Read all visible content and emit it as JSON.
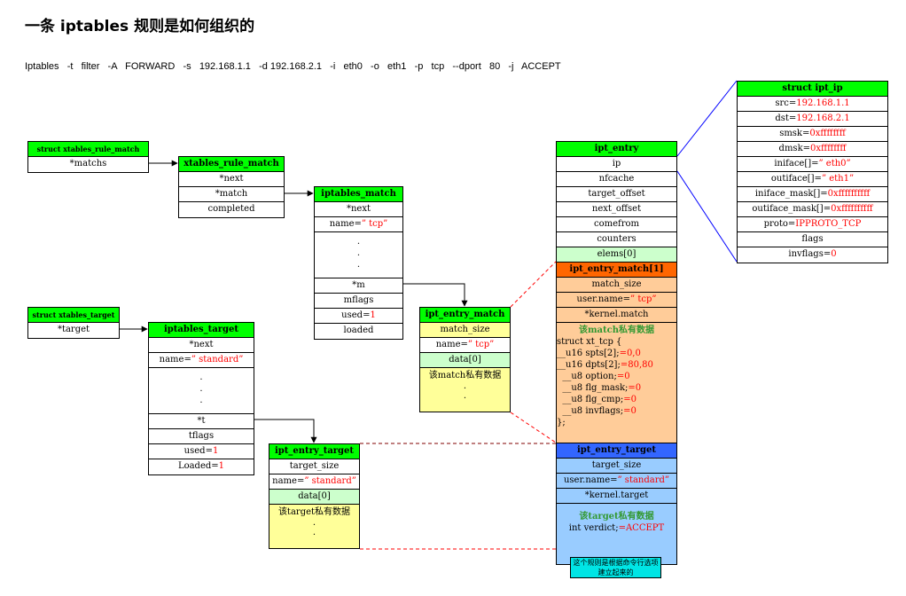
{
  "title": "一条 iptables 规则是如何组织的",
  "command": "Iptables   -t   filter   -A   FORWARD   -s   192.168.1.1   -d 192.168.2.1   -i   eth0   -o   eth1   -p   tcp   --dport   80   -j   ACCEPT",
  "xtables_rule_match_struct": {
    "header": "struct xtables_rule_match",
    "field": "*matchs"
  },
  "xtables_rule_match": {
    "header": "xtables_rule_match",
    "fields": [
      "*next",
      "*match",
      "completed"
    ]
  },
  "iptables_match": {
    "header": "iptables_match",
    "next": "*next",
    "name_label": "name=",
    "name_value": "” tcp”",
    "dots": ".\n.\n.",
    "m": "*m",
    "mflags": "mflags",
    "used_label": "used=",
    "used_value": "1",
    "loaded": "loaded"
  },
  "xtables_target_struct": {
    "header": "struct xtables_target",
    "field": "*target"
  },
  "iptables_target": {
    "header": "iptables_target",
    "next": "*next",
    "name_label": "name=",
    "name_value": "” standard”",
    "dots": ".\n.\n.",
    "t": "*t",
    "tflags": "tflags",
    "used_label": "used=",
    "used_value": "1",
    "loaded_label": "Loaded=",
    "loaded_value": "1"
  },
  "ipt_entry_match": {
    "header": "ipt_entry_match",
    "match_size": "match_size",
    "name_label": "name=",
    "name_value": "” tcp”",
    "data": "data[0]",
    "private": "该match私有数据",
    "dots": ".\n."
  },
  "ipt_entry_target": {
    "header": "ipt_entry_target",
    "target_size": "target_size",
    "name_label": "name=",
    "name_value": "” standard”",
    "data": "data[0]",
    "private": "该target私有数据",
    "dots": ".\n."
  },
  "ipt_entry": {
    "header": "ipt_entry",
    "fields": [
      "ip",
      "nfcache",
      "target_offset",
      "next_offset",
      "comefrom",
      "counters"
    ],
    "elems": "elems[0]",
    "match_header": "ipt_entry_match[1]",
    "match_size": "match_size",
    "user_name_label": "user.name=",
    "user_name_value": "” tcp”",
    "kernel_match": "*kernel.match",
    "match_private": "该match私有数据",
    "tcp_lines": [
      {
        "k": "struct xt_tcp {",
        "v": ""
      },
      {
        "k": "__u16 spts[2];",
        "v": "=0,0"
      },
      {
        "k": "__u16 dpts[2];",
        "v": "=80,80"
      },
      {
        "k": "  __u8 option;",
        "v": "=0"
      },
      {
        "k": "  __u8 flg_mask;",
        "v": "=0"
      },
      {
        "k": "  __u8 flg_cmp;",
        "v": "=0"
      },
      {
        "k": "  __u8 invflags;",
        "v": "=0"
      },
      {
        "k": "};",
        "v": ""
      }
    ],
    "target_header": "ipt_entry_target",
    "target_size": "target_size",
    "user_target_label": "user.name=",
    "user_target_value": "” standard”",
    "kernel_target": "*kernel.target",
    "target_private": "该target私有数据",
    "verdict_label": "int verdict;",
    "verdict_value": "=ACCEPT"
  },
  "ipt_ip": {
    "header": "struct ipt_ip",
    "rows": [
      {
        "k": "src=",
        "v": "192.168.1.1"
      },
      {
        "k": "dst=",
        "v": "192.168.2.1"
      },
      {
        "k": "smsk=",
        "v": "0xffffffff"
      },
      {
        "k": "dmsk=",
        "v": "0xffffffff"
      },
      {
        "k": "iniface[]=",
        "v": "” eth0”"
      },
      {
        "k": "outiface[]=",
        "v": "” eth1”"
      },
      {
        "k": "iniface_mask[]=",
        "v": "0xffffffffff"
      },
      {
        "k": "outiface_mask[]=",
        "v": "0xffffffffff"
      },
      {
        "k": "proto=",
        "v": "IPPROTO_TCP"
      },
      {
        "k": "flags",
        "v": ""
      },
      {
        "k": "invflags=",
        "v": "0"
      }
    ]
  },
  "note": "这个规则是根据命令行选项建立起来的",
  "colors": {
    "header_green": "#00ff00",
    "match_orange": "#ff6600",
    "target_blue": "#3366ff",
    "value_red": "#ff0000",
    "note_cyan": "#00e5e5"
  }
}
